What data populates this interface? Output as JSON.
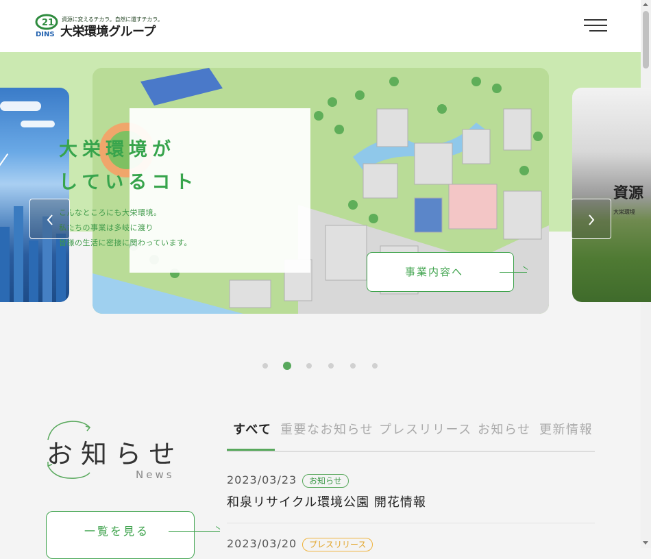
{
  "header": {
    "logo_tagline": "資源に変えるチカラ。自然に還すチカラ。",
    "logo_name": "大栄環境グループ",
    "logo_mark_number": "21",
    "logo_mark_letters": "DINS"
  },
  "carousel": {
    "main_slide": {
      "title_line1": "大栄環境が",
      "title_line2": "しているコト",
      "text_line1": "こんなところにも大栄環境。",
      "text_line2": "私たちの事業は多岐に渡り",
      "text_line3": "皆様の生活に密接に関わっています。",
      "button_label": "事業内容へ"
    },
    "right_slide": {
      "title": "資源",
      "sub": "大栄環境"
    },
    "prev_icon": "chevron-left-icon",
    "next_icon": "chevron-right-icon",
    "dots_count": 6,
    "active_dot": 2
  },
  "news": {
    "title": "お知らせ",
    "title_en": "News",
    "more_label": "一覧を見る",
    "tabs": [
      {
        "label": "すべて"
      },
      {
        "label": "重要なお知らせ"
      },
      {
        "label": "プレスリリース"
      },
      {
        "label": "お知らせ"
      },
      {
        "label": "更新情報"
      }
    ],
    "items": [
      {
        "date": "2023/03/23",
        "category": "お知らせ",
        "headline": "和泉リサイクル環境公園 開花情報"
      },
      {
        "date": "2023/03/20",
        "category": "プレスリリース",
        "headline": ""
      }
    ]
  },
  "colors": {
    "brand_green": "#3fa34d",
    "hero_band": "#cbe9b1",
    "badge_orange": "#efb23a"
  }
}
